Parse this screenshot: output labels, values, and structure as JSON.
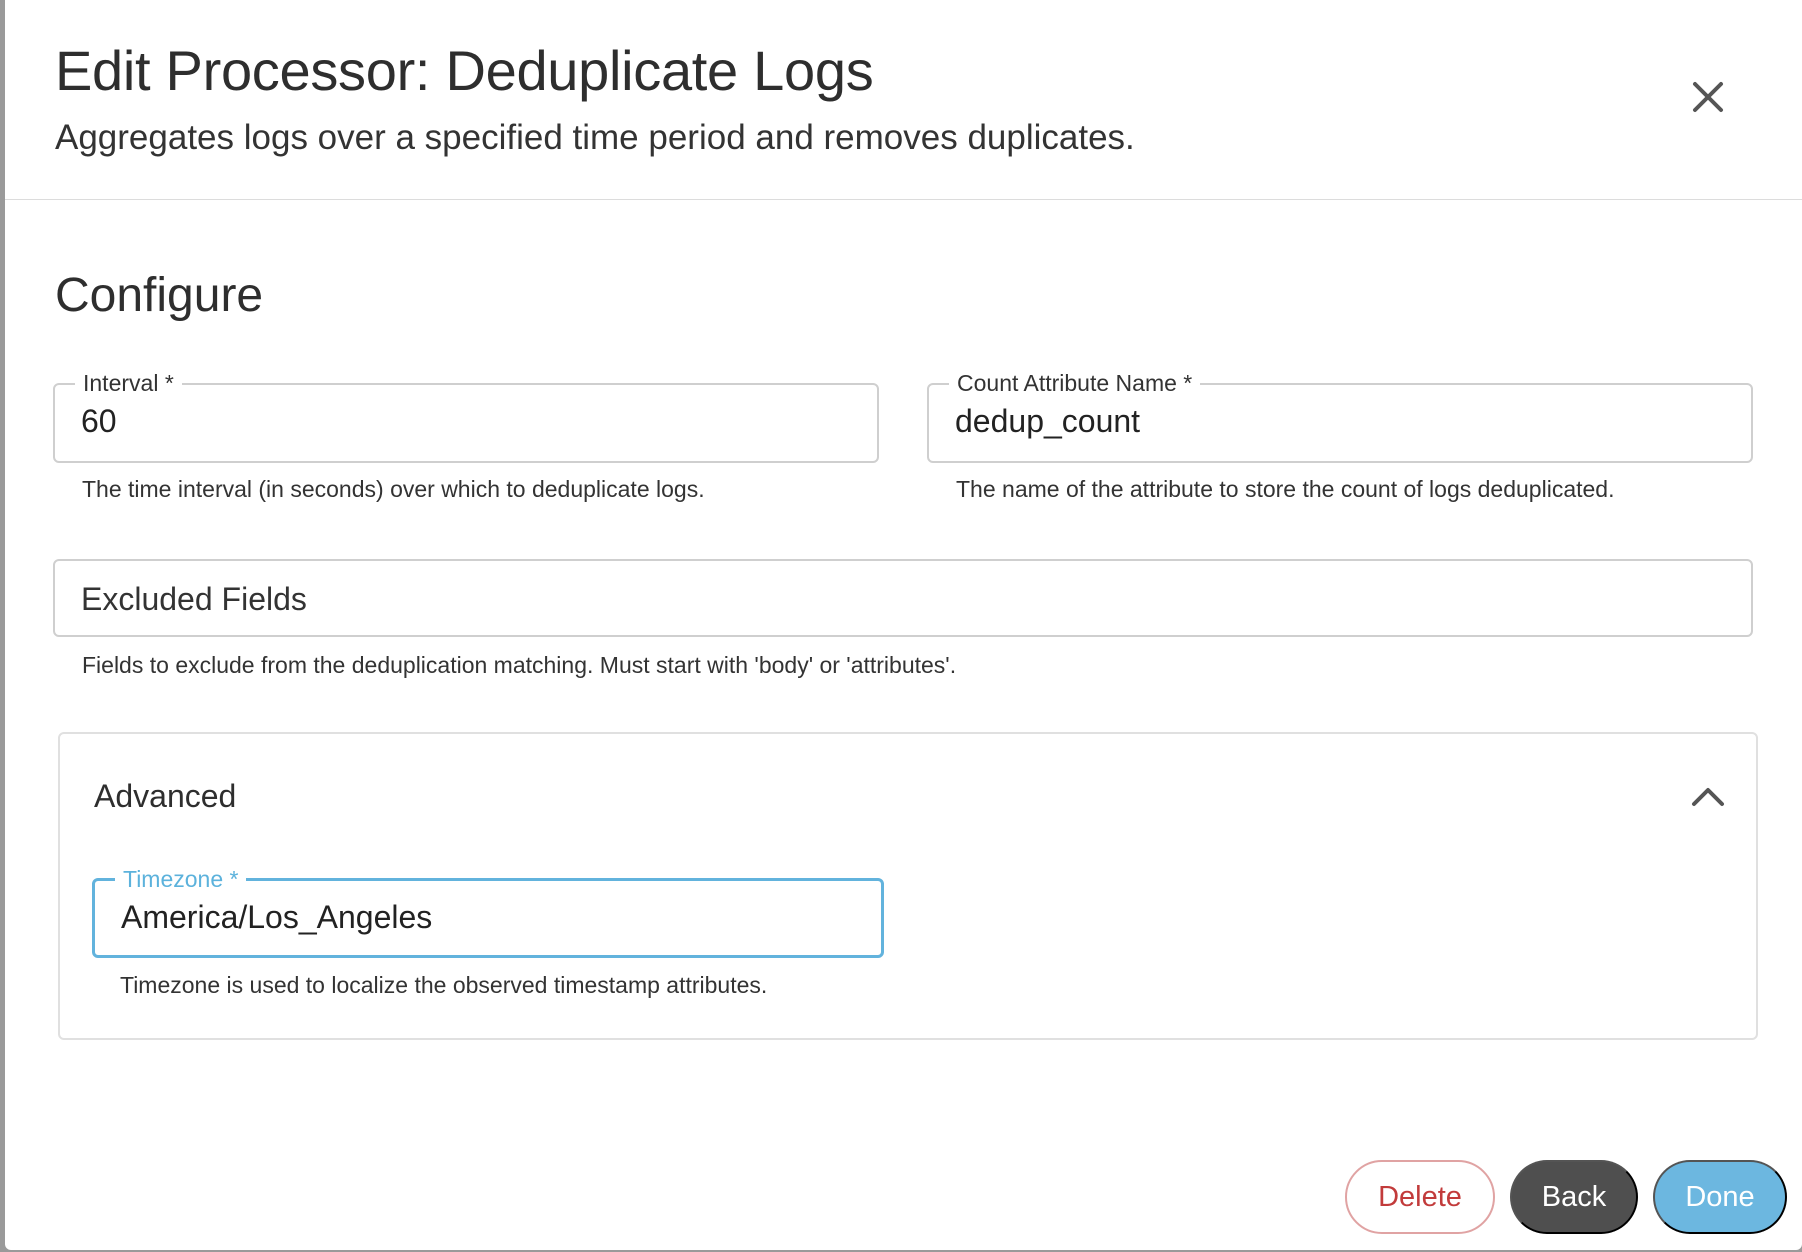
{
  "dialog": {
    "title": "Edit Processor: Deduplicate Logs",
    "subtitle": "Aggregates logs over a specified time period and removes duplicates.",
    "close_icon": "close-icon"
  },
  "configure": {
    "heading": "Configure",
    "interval": {
      "label": "Interval *",
      "value": "60",
      "helper": "The time interval (in seconds) over which to deduplicate logs."
    },
    "count_attribute": {
      "label": "Count Attribute Name *",
      "value": "dedup_count",
      "helper": "The name of the attribute to store the count of logs deduplicated."
    },
    "excluded_fields": {
      "placeholder": "Excluded Fields",
      "helper": "Fields to exclude from the deduplication matching. Must start with 'body' or 'attributes'."
    }
  },
  "advanced": {
    "title": "Advanced",
    "expanded": true,
    "chevron_icon": "chevron-up-icon",
    "timezone": {
      "label": "Timezone *",
      "value": "America/Los_Angeles",
      "helper": "Timezone is used to localize the observed timestamp attributes."
    }
  },
  "actions": {
    "delete_label": "Delete",
    "back_label": "Back",
    "done_label": "Done"
  },
  "colors": {
    "accent": "#62b3dd",
    "danger": "#c23b3b",
    "back_button": "#4f4f4f",
    "done_button": "#6cb7e0"
  }
}
